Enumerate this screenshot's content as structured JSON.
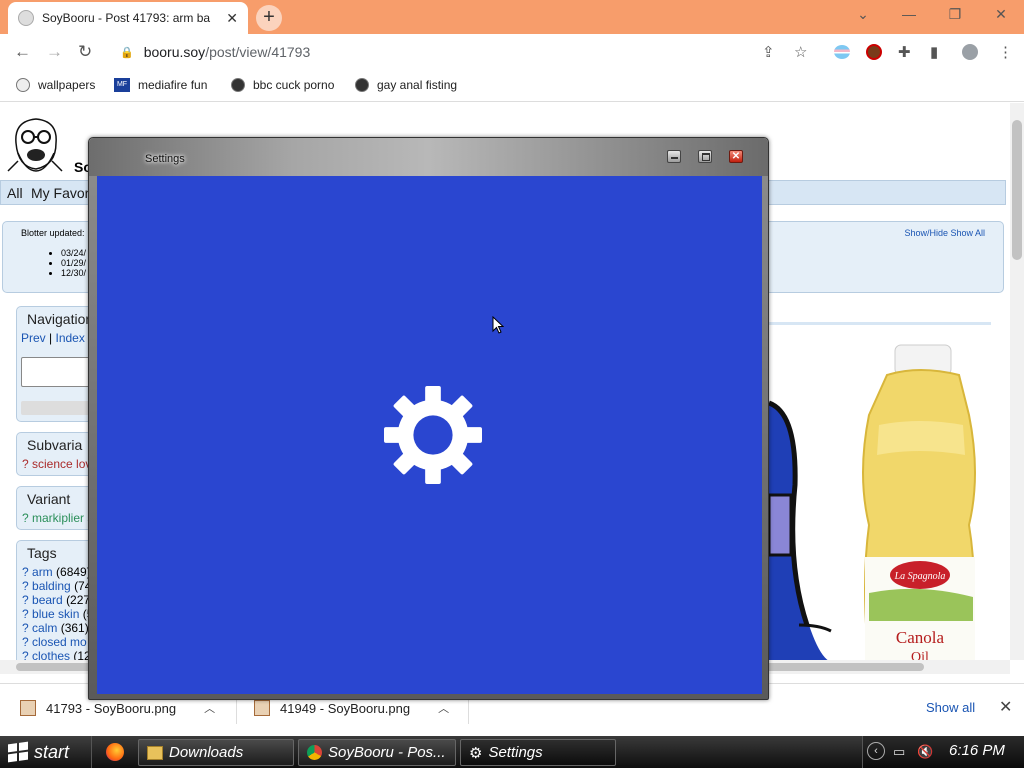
{
  "browser": {
    "tab_title": "SoyBooru - Post 41793: arm ba",
    "url_host": "booru.soy",
    "url_path": "/post/view/41793",
    "bookmarks": [
      "wallpapers",
      "mediafire fun",
      "bbc cuck porno",
      "gay anal fisting"
    ],
    "mediafire_badge": "MF"
  },
  "page": {
    "site_letter": "So",
    "nav_all": "All",
    "nav_fav": "My Favor",
    "blotter_label": "Blotter updated:",
    "blotter_dates": [
      "03/24/",
      "01/29/",
      "12/30/"
    ],
    "blotter_toggle": "Show/Hide Show All",
    "navigation_title": "Navigation",
    "prev": "Prev",
    "sep": "|",
    "index": "Index",
    "subvariants_title": "Subvaria",
    "subvariant_item": "? science lov",
    "variant_title": "Variant",
    "variant_item": "? markiplier s",
    "tags_title": "Tags",
    "tags": [
      {
        "name": "arm",
        "count": "(6849)"
      },
      {
        "name": "balding",
        "count": "(74"
      },
      {
        "name": "beard",
        "count": "(227"
      },
      {
        "name": "blue skin",
        "count": "(5"
      },
      {
        "name": "calm",
        "count": "(361)"
      },
      {
        "name": "closed mo",
        "count": ""
      },
      {
        "name": "clothes",
        "count": "(12"
      }
    ],
    "product_brand": "La Spagnola",
    "product_name": "Canola",
    "product_sub": "Oil"
  },
  "dialog": {
    "title": "Settings",
    "close_glyph": "✕",
    "body_color": "#2a46d0"
  },
  "downloads": {
    "items": [
      "41793 - SoyBooru.png",
      "41949 - SoyBooru.png"
    ],
    "show_all": "Show all"
  },
  "taskbar": {
    "start_label": "start",
    "tasks": [
      "Downloads",
      "SoyBooru - Pos...",
      "Settings"
    ],
    "clock": "6:16 PM"
  }
}
